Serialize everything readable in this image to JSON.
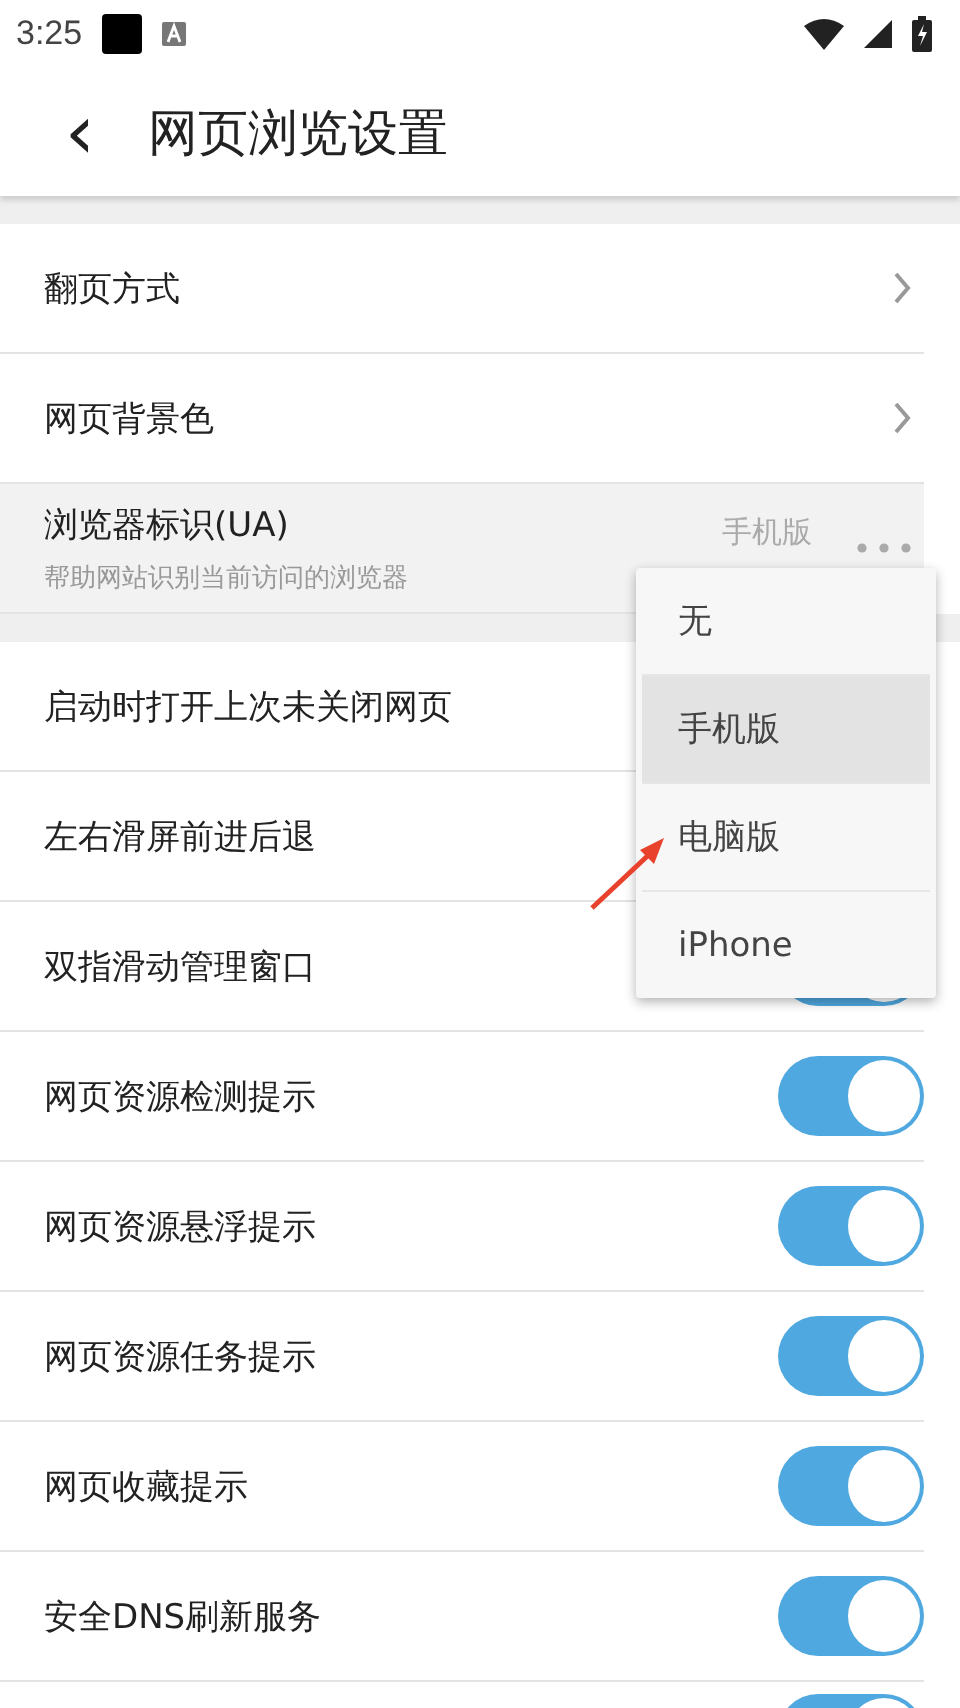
{
  "status_bar": {
    "time": "3:25"
  },
  "app_bar": {
    "back": "‹",
    "title": "网页浏览设置"
  },
  "groups": [
    {
      "items": [
        {
          "kind": "link",
          "label": "翻页方式"
        },
        {
          "kind": "link",
          "label": "网页背景色"
        },
        {
          "kind": "menu",
          "label": "浏览器标识(UA)",
          "subtitle": "帮助网站识别当前访问的浏览器",
          "value": "手机版",
          "pressed": true
        }
      ]
    },
    {
      "items": [
        {
          "kind": "switch",
          "label": "启动时打开上次未关闭网页"
        },
        {
          "kind": "switch",
          "label": "左右滑屏前进后退"
        },
        {
          "kind": "switch",
          "label": "双指滑动管理窗口",
          "on": true
        },
        {
          "kind": "switch",
          "label": "网页资源检测提示",
          "on": true
        },
        {
          "kind": "switch",
          "label": "网页资源悬浮提示",
          "on": true
        },
        {
          "kind": "switch",
          "label": "网页资源任务提示",
          "on": true
        },
        {
          "kind": "switch",
          "label": "网页收藏提示",
          "on": true
        },
        {
          "kind": "switch",
          "label": "安全DNS刷新服务",
          "on": true
        },
        {
          "kind": "switch",
          "on": true
        }
      ]
    }
  ],
  "popup_menu": {
    "options": [
      {
        "label": "无",
        "selected": false
      },
      {
        "label": "手机版",
        "selected": true
      },
      {
        "label": "电脑版",
        "selected": false
      },
      {
        "label": "iPhone",
        "selected": false
      }
    ]
  }
}
